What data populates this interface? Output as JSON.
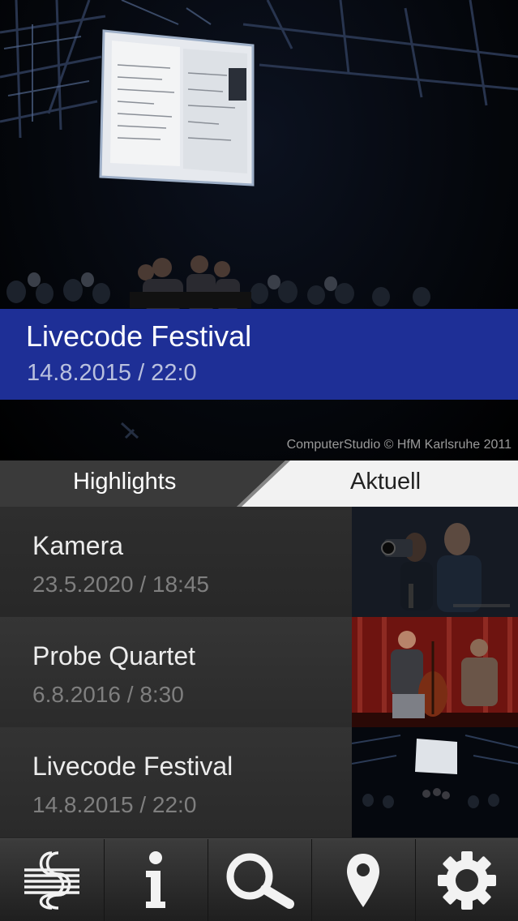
{
  "hero": {
    "title": "Livecode Festival",
    "date": "14.8.2015 / 22:0",
    "credit": "ComputerStudio © HfM Karlsruhe 2011",
    "banner_color": "#1e2f96"
  },
  "tabs": [
    {
      "label": "Highlights",
      "active": true
    },
    {
      "label": "Aktuell",
      "active": false
    }
  ],
  "events": [
    {
      "title": "Kamera",
      "date": "23.5.2020 / 18:45",
      "thumb": "camera-crew-photo"
    },
    {
      "title": "Probe Quartet",
      "date": "6.8.2016 / 8:30",
      "thumb": "cello-rehearsal-photo"
    },
    {
      "title": "Livecode Festival",
      "date": "14.8.2015 / 22:0",
      "thumb": "livecode-stage-photo"
    }
  ],
  "toolbar": [
    {
      "icon": "hfm-logo-icon"
    },
    {
      "icon": "info-icon"
    },
    {
      "icon": "search-icon"
    },
    {
      "icon": "location-pin-icon"
    },
    {
      "icon": "settings-gear-icon"
    }
  ]
}
